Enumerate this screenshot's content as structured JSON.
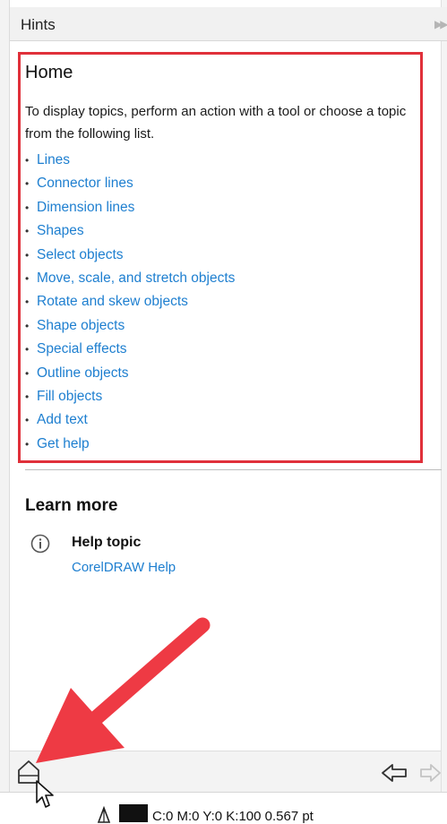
{
  "panel_title": "Hints",
  "home": {
    "title": "Home",
    "intro": "To display topics, perform an action with a tool or choose a topic from the following list.",
    "bullet": "•",
    "topics": [
      "Lines",
      "Connector lines",
      "Dimension lines",
      "Shapes",
      "Select objects",
      "Move, scale, and stretch objects",
      "Rotate and skew objects",
      "Shape objects",
      "Special effects",
      "Outline objects",
      "Fill objects",
      "Add text",
      "Get help"
    ]
  },
  "learn_more": {
    "title": "Learn more",
    "help_label": "Help topic",
    "help_link": "CorelDRAW Help"
  },
  "status": {
    "outline_text": "C:0 M:0 Y:0 K:100  0.567 pt",
    "swatch_color": "#111111"
  },
  "colors": {
    "link": "#1e7fd0",
    "highlight": "#e0303a",
    "arrow": "#ee3a44"
  },
  "icons": [
    "collapse-icon",
    "info-icon",
    "home-icon",
    "back-arrow-icon",
    "forward-arrow-icon",
    "pen-outline-icon",
    "mouse-cursor-icon"
  ]
}
